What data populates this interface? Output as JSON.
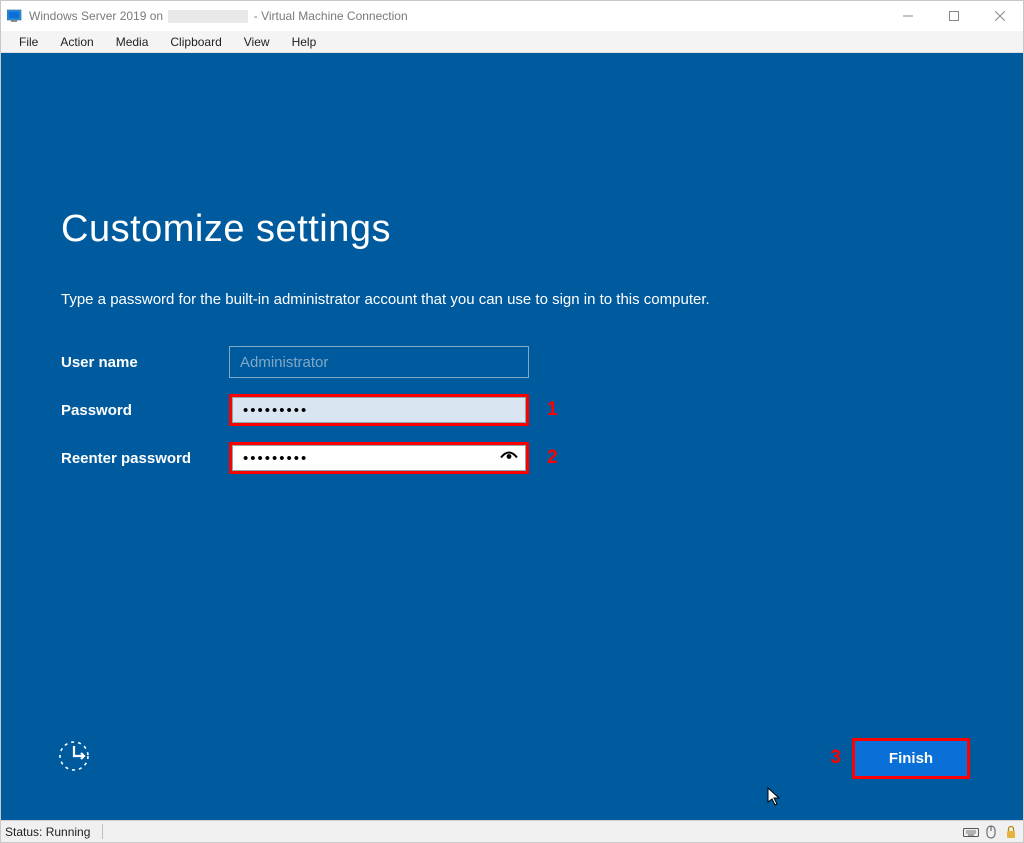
{
  "titlebar": {
    "title_prefix": "Windows Server 2019 on",
    "title_suffix": "- Virtual Machine Connection"
  },
  "window_controls": {
    "minimize": "Minimize",
    "maximize": "Maximize",
    "close": "Close"
  },
  "menubar": {
    "items": [
      "File",
      "Action",
      "Media",
      "Clipboard",
      "View",
      "Help"
    ]
  },
  "oobe": {
    "heading": "Customize settings",
    "description": "Type a password for the built-in administrator account that you can use to sign in to this computer.",
    "username_label": "User name",
    "username_value": "Administrator",
    "password_label": "Password",
    "password_value": "•••••••••",
    "reenter_label": "Reenter password",
    "reenter_value": "•••••••••",
    "finish_label": "Finish"
  },
  "annotations": {
    "callout1": "1",
    "callout2": "2",
    "callout3": "3"
  },
  "statusbar": {
    "status": "Status: Running"
  }
}
